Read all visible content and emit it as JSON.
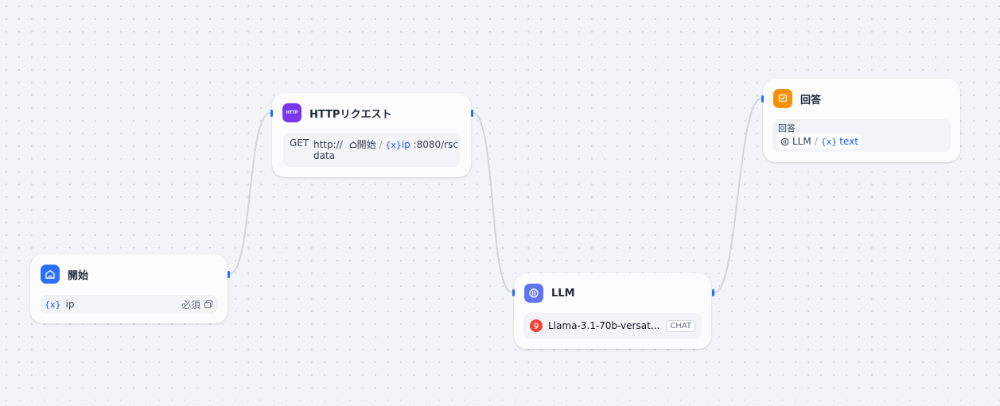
{
  "colors": {
    "edge": "#d0d5dd",
    "handle": "#296dff",
    "start_icon_bg": "#2970ff",
    "http_icon_bg": "#7839ee",
    "llm_icon_bg": "#6172f3",
    "answer_icon_bg": "#f79009",
    "model_icon_bg": "#f04438"
  },
  "start_node": {
    "title": "開始",
    "icon": "home-icon",
    "variable": {
      "prefix": "{x}",
      "name": "ip",
      "required": "必須",
      "icon": "copy-icon"
    }
  },
  "http_node": {
    "title": "HTTPリクエスト",
    "icon_label": "HTTP",
    "method": "GET",
    "url_prefix": "http://",
    "url_ref_node": "開始",
    "separator": "/",
    "url_ref_prefix": "{x}",
    "url_ref_var": "ip",
    "url_suffix": ":8080/rsc",
    "url_line2": "data"
  },
  "llm_node": {
    "title": "LLM",
    "icon": "llm-icon",
    "model_icon": "model-provider-icon",
    "model_name": "Llama-3.1-70b-versat...",
    "mode_badge": "CHAT"
  },
  "answer_node": {
    "title": "回答",
    "icon": "answer-icon",
    "field_label": "回答",
    "ref_node": "LLM",
    "separator": "/",
    "ref_prefix": "{x}",
    "ref_var": "text"
  }
}
